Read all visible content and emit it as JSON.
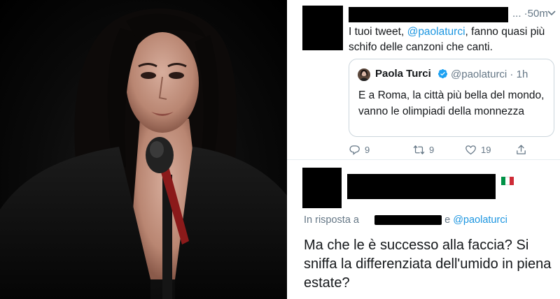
{
  "tweet1": {
    "meta": "... ·50m",
    "text_prefix": "I tuoi tweet, ",
    "mention": "@paolaturci",
    "text_suffix": ", fanno quasi più schifo delle canzoni che canti."
  },
  "quoted_tweet": {
    "name": "Paola Turci",
    "handle": "@paolaturci · 1h",
    "text": "E a Roma, la città più bella del mondo, vanno le olimpiadi della monnezza",
    "verified": true
  },
  "actions": {
    "replies": "9",
    "retweets": "9",
    "likes": "19"
  },
  "tweet2": {
    "reply_prefix": "In risposta a",
    "reply_and": "e",
    "reply_mention": "@paolaturci",
    "text": "Ma che le è successo alla faccia? Si sniffa la differenziata dell'umido in piena estate?",
    "flag": "italy-flag",
    "flag_colors": [
      "#009246",
      "#ffffff",
      "#ce2b37"
    ]
  },
  "colors": {
    "link": "#1b95e0",
    "secondary_text": "#657786",
    "border": "#ccd6dd",
    "verified": "#1da1f2"
  }
}
